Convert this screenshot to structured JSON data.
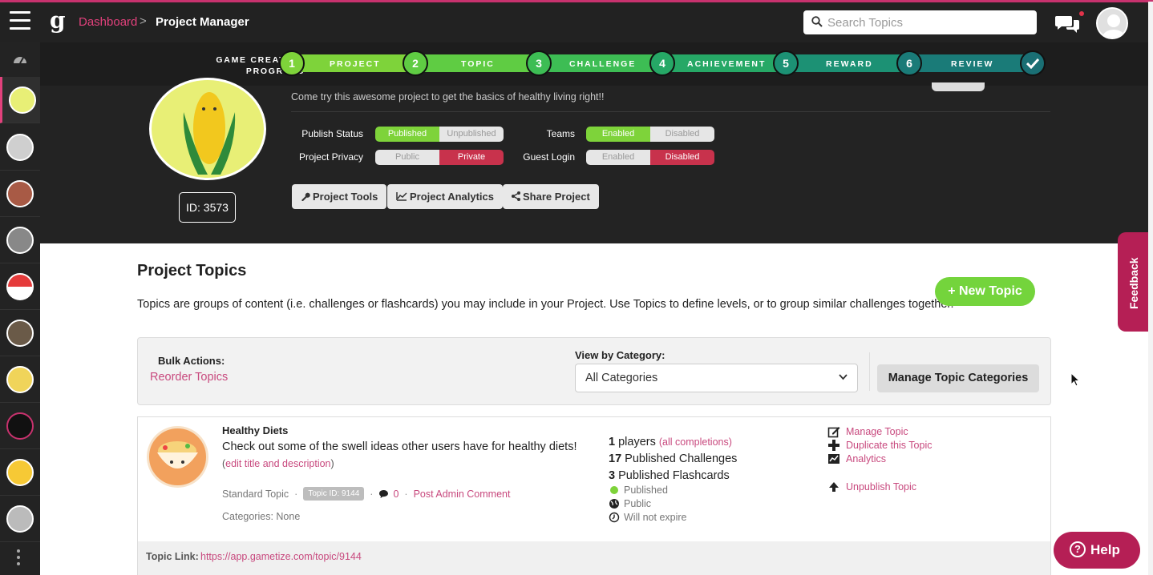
{
  "header": {
    "breadcrumb_link": "Dashboard",
    "breadcrumb_sep": ">",
    "breadcrumb_current": "Project Manager",
    "search_placeholder": "Search Topics",
    "logo_letter": "g"
  },
  "progress": {
    "label": "GAME CREATION PROGRESS",
    "steps": [
      {
        "num": "1",
        "label": "PROJECT"
      },
      {
        "num": "2",
        "label": "TOPIC"
      },
      {
        "num": "3",
        "label": "CHALLENGE"
      },
      {
        "num": "4",
        "label": "ACHIEVEMENT"
      },
      {
        "num": "5",
        "label": "REWARD"
      },
      {
        "num": "6",
        "label": "REVIEW"
      }
    ]
  },
  "project": {
    "description": "Come try this awesome project to get the basics of healthy living right!!",
    "id_label": "ID: 3573",
    "publish_status": {
      "label": "Publish Status",
      "on": "Published",
      "off": "Unpublished"
    },
    "privacy": {
      "label": "Project Privacy",
      "off": "Public",
      "on": "Private"
    },
    "teams": {
      "label": "Teams",
      "on": "Enabled",
      "off": "Disabled"
    },
    "guest_login": {
      "label": "Guest Login",
      "off": "Enabled",
      "on": "Disabled"
    },
    "buttons": {
      "tools": "Project Tools",
      "analytics": "Project Analytics",
      "share": "Share Project"
    }
  },
  "topics_section": {
    "title": "Project Topics",
    "description": "Topics are groups of content (i.e. challenges or flashcards) you may include in your Project. Use Topics to define levels, or to group similar challenges together.",
    "new_topic": "+ New Topic",
    "bulk_title": "Bulk Actions:",
    "reorder": "Reorder Topics",
    "view_title": "View by Category:",
    "category_selected": "All Categories",
    "manage_categories": "Manage Topic Categories"
  },
  "topic": {
    "title": "Healthy Diets",
    "description": "Check out some of the swell ideas other users have for healthy diets!",
    "edit_link": "edit title and description",
    "type": "Standard Topic",
    "id_badge": "Topic ID: 9144",
    "comment_count": "0",
    "post_comment": "Post Admin Comment",
    "categories": "Categories: None",
    "players_count": "1",
    "players_label": "players",
    "all_completions": "(all completions)",
    "challenges_count": "17",
    "challenges_label": "Published Challenges",
    "flashcards_count": "3",
    "flashcards_label": "Published Flashcards",
    "status_published": "Published",
    "status_public": "Public",
    "status_expire": "Will not expire",
    "actions": {
      "manage": "Manage Topic",
      "duplicate": "Duplicate this Topic",
      "analytics": "Analytics",
      "unpublish": "Unpublish Topic"
    },
    "link_label": "Topic Link:",
    "link_url": "https://app.gametize.com/topic/9144"
  },
  "widgets": {
    "feedback": "Feedback",
    "help": "Help",
    "help_q": "?"
  },
  "colors": {
    "accent_pink": "#c8497e",
    "green": "#74d43c",
    "red": "#c8324c",
    "dark": "#232323"
  }
}
